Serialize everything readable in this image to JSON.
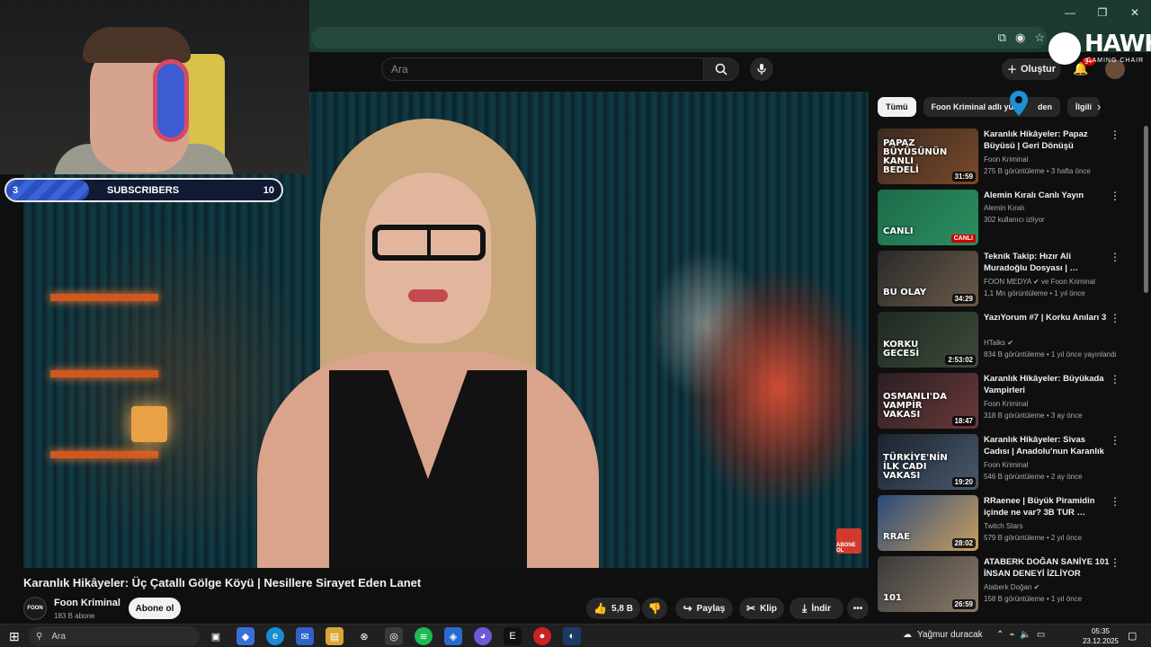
{
  "window": {
    "controls": [
      "—",
      "❐",
      "✕"
    ]
  },
  "masthead": {
    "search_placeholder": "Ara",
    "create_label": "Oluştur",
    "notification_count": "9+"
  },
  "overlay": {
    "brand": "HAWK",
    "brand_sub": "GAMING CHAIR",
    "subscriber_goal": {
      "current": "3",
      "label": "SUBSCRIBERS",
      "goal": "10",
      "progress": 0.3
    }
  },
  "video": {
    "title": "Karanlık Hikâyeler: Üç Çatallı Gölge Köyü | Nesillere Sirayet Eden Lanet",
    "channel_logo_text": "FOON",
    "channel_name": "Foon Kriminal",
    "channel_subs": "183 B abone",
    "subscribe_label": "Abone ol",
    "likes": "5,8 B",
    "share_label": "Paylaş",
    "clip_label": "Klip",
    "download_label": "İndir",
    "corner_badge": "ABONE OL"
  },
  "chips": [
    "Tümü",
    "Foon Kriminal adlı yük",
    "den",
    "İlgili"
  ],
  "recommendations": [
    {
      "title": "Karanlık Hikâyeler: Papaz Büyüsü | Geri Dönüşü Olmayan…",
      "channel": "Foon Kriminal",
      "meta": "275 B görüntüleme • 3 hafta önce",
      "duration": "31:59",
      "caption": "PAPAZ BÜYÜSÜNÜN KANLI BEDELİ",
      "colors": [
        "#3a2a22",
        "#7a4a2a"
      ]
    },
    {
      "title": "Alemin Kıralı Canlı Yayın",
      "channel": "Alemin Kıralı",
      "meta": "302 kullanıcı izliyor",
      "live": "CANLI",
      "caption": "CANLI",
      "colors": [
        "#1b6b4a",
        "#2c8f5f"
      ]
    },
    {
      "title": "Teknik Takip: Hızır Ali Muradoğlu Dosyası | …",
      "channel": "FOON MEDYA ✔ ve Foon Kriminal",
      "meta": "1,1 Mn görüntüleme • 1 yıl önce",
      "duration": "34:29",
      "caption": "BU OLAY",
      "colors": [
        "#2a2a2a",
        "#6a5a4a"
      ]
    },
    {
      "title": "YazıYorum #7 | Korku Anıları 3",
      "channel": "HTalks ✔",
      "meta": "834 B görüntüleme • 1 yıl önce yayınlandı",
      "duration": "2:53:02",
      "caption": "KORKU GECESİ",
      "colors": [
        "#1e2a22",
        "#3d4a3a"
      ]
    },
    {
      "title": "Karanlık Hikâyeler: Büyükada Vampirleri",
      "channel": "Foon Kriminal",
      "meta": "318 B görüntüleme • 3 ay önce",
      "duration": "18:47",
      "caption": "OSMANLI'DA VAMPİR VAKASI",
      "colors": [
        "#2a1e22",
        "#6a3a3a"
      ]
    },
    {
      "title": "Karanlık Hikâyeler: Sivas Cadısı | Anadolu'nun Karanlık Efsanesi",
      "channel": "Foon Kriminal",
      "meta": "546 B görüntüleme • 2 ay önce",
      "duration": "19:20",
      "caption": "TÜRKİYE'NİN İLK CADI VAKASI",
      "colors": [
        "#1a2230",
        "#4a5a6a"
      ]
    },
    {
      "title": "RRaenee | Büyük Piramidin içinde ne var? 3B TUR …",
      "channel": "Twitch Stars",
      "meta": "579 B görüntüleme • 2 yıl önce",
      "duration": "28:02",
      "caption": "RRAE",
      "colors": [
        "#2a4a7a",
        "#c8a060"
      ]
    },
    {
      "title": "ATABERK DOĞAN SANİYE 101 İNSAN DENEYİ İZLİYOR",
      "channel": "Ataberk Doğan ✔",
      "meta": "158 B görüntüleme • 1 yıl önce",
      "duration": "26:59",
      "caption": "101",
      "colors": [
        "#3a3a3a",
        "#8a7a6a"
      ]
    }
  ],
  "taskbar": {
    "search_label": "Ara",
    "weather": "Yağmur duracak",
    "time": "05:35",
    "date": "23.12.2025"
  }
}
